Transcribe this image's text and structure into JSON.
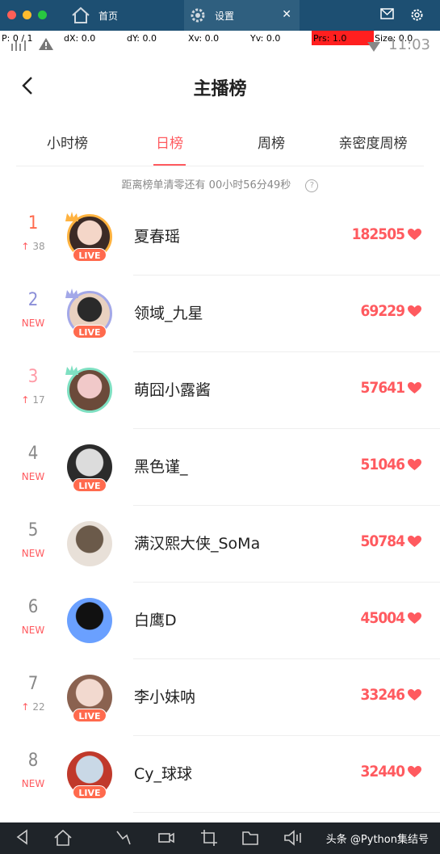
{
  "chrome": {
    "tabs": [
      {
        "label": "首页",
        "icon": "home-icon"
      },
      {
        "label": "设置",
        "icon": "gear-icon",
        "close": "✕"
      }
    ],
    "right_icons": [
      "mail-icon",
      "settings-icon"
    ]
  },
  "debug": {
    "p": "P: 0 / 1",
    "dx": "dX: 0.0",
    "dy": "dY: 0.0",
    "xv": "Xv: 0.0",
    "yv": "Yv: 0.0",
    "prs": "Prs: 1.0",
    "size": "Size: 0.0",
    "clock": "11:03"
  },
  "header": {
    "title": "主播榜"
  },
  "tabs": [
    "小时榜",
    "日榜",
    "周榜",
    "亲密度周榜"
  ],
  "active_tab": "日榜",
  "countdown": "距离榜单清零还有 00小时56分49秒",
  "help": "?",
  "live_label": "LIVE",
  "colors": {
    "accent": "#ff5a5f",
    "live": "#ff6a4d",
    "rank1": "#ff6a4d",
    "rank2": "#8b8fd8",
    "rank3": "#ff9aa6",
    "rank_default": "#888888"
  },
  "rankings": [
    {
      "rank": "1",
      "change": "38",
      "change_type": "up",
      "name": "夏春瑶",
      "score": "182505",
      "live": true
    },
    {
      "rank": "2",
      "change": "NEW",
      "change_type": "new",
      "name": "领域_九星",
      "score": "69229",
      "live": true
    },
    {
      "rank": "3",
      "change": "17",
      "change_type": "up",
      "name": "萌囧小露酱",
      "score": "57641",
      "live": false
    },
    {
      "rank": "4",
      "change": "NEW",
      "change_type": "new",
      "name": "黑色谨_",
      "score": "51046",
      "live": true
    },
    {
      "rank": "5",
      "change": "NEW",
      "change_type": "new",
      "name": "满汉熙大侠_SoMa",
      "score": "50784",
      "live": false
    },
    {
      "rank": "6",
      "change": "NEW",
      "change_type": "new",
      "name": "白鹰D",
      "score": "45004",
      "live": false
    },
    {
      "rank": "7",
      "change": "22",
      "change_type": "up",
      "name": "李小妹呐",
      "score": "33246",
      "live": true
    },
    {
      "rank": "8",
      "change": "NEW",
      "change_type": "new",
      "name": "Cy_球球",
      "score": "32440",
      "live": true
    }
  ],
  "navbar": {
    "items": [
      "back-icon",
      "home-icon",
      "gesture-icon",
      "video-icon",
      "crop-icon",
      "folder-icon",
      "volume-icon"
    ],
    "watermark": "头条 @Python集结号"
  }
}
